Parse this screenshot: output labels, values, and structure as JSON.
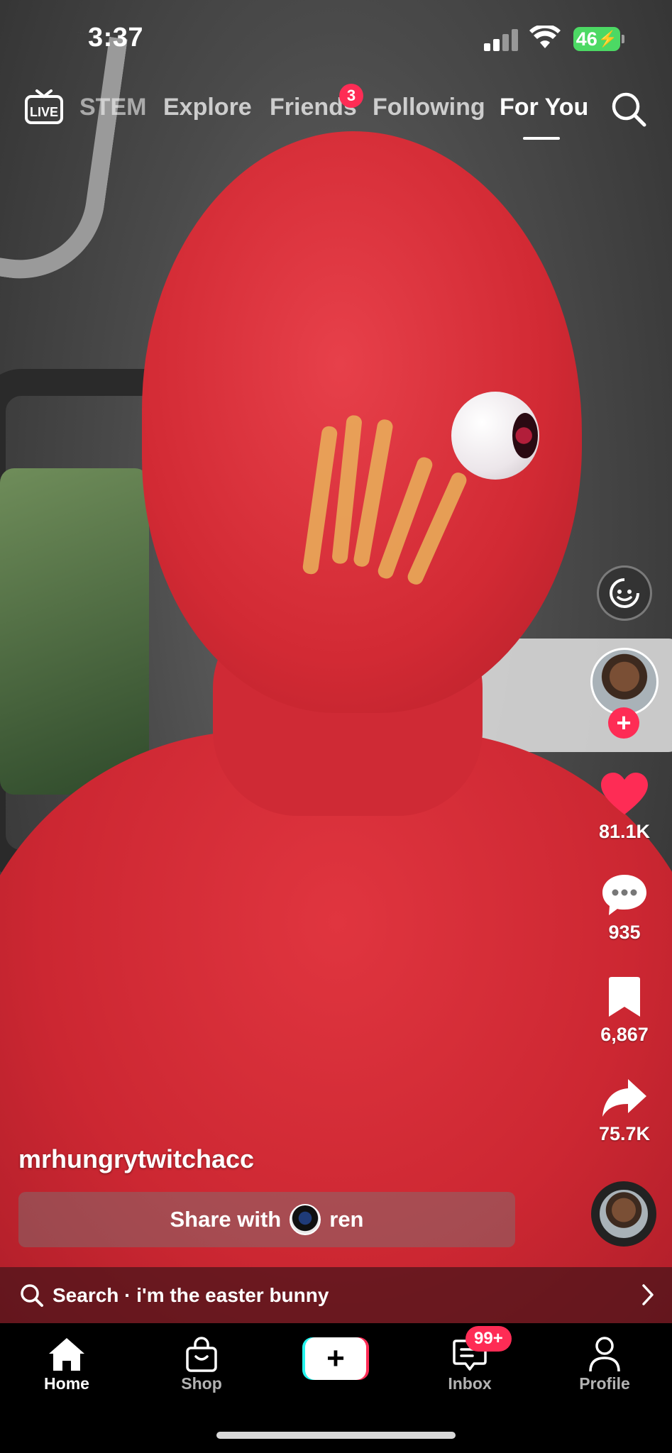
{
  "status_bar": {
    "time": "3:37",
    "battery": "46"
  },
  "top_nav": {
    "tabs": [
      {
        "label": "STEM"
      },
      {
        "label": "Explore"
      },
      {
        "label": "Friends",
        "badge": "3"
      },
      {
        "label": "Following"
      },
      {
        "label": "For You",
        "active": true
      }
    ]
  },
  "actions": {
    "likes": "81.1K",
    "comments": "935",
    "saves": "6,867",
    "shares": "75.7K"
  },
  "post": {
    "username": "mrhungrytwitchacc"
  },
  "share_with": {
    "prefix": "Share with",
    "name": "ren"
  },
  "search_bar": {
    "text": "Search · i'm the easter bunny"
  },
  "bottom_tabs": {
    "home": "Home",
    "shop": "Shop",
    "inbox": "Inbox",
    "inbox_badge": "99+",
    "profile": "Profile"
  },
  "colors": {
    "accent": "#fe2c55",
    "create_cyan": "#25f4ee",
    "battery": "#4cd964"
  },
  "icons": [
    "live-icon",
    "search-icon",
    "emoji-icon",
    "heart-icon",
    "comment-icon",
    "bookmark-icon",
    "share-icon",
    "home-icon",
    "shop-icon",
    "plus-icon",
    "inbox-icon",
    "profile-icon",
    "chevron-right-icon"
  ]
}
